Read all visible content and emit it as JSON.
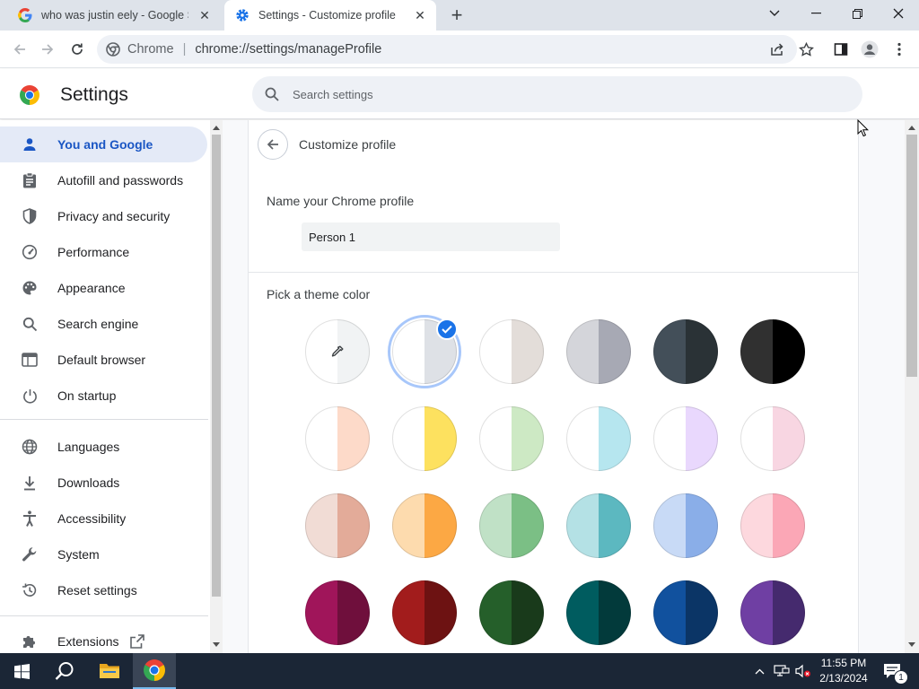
{
  "browser": {
    "tabs": [
      {
        "title": "who was justin eely - Google Search",
        "icon": "google-icon"
      },
      {
        "title": "Settings - Customize profile",
        "icon": "settings-gear-icon"
      }
    ],
    "omnibox": {
      "site": "Chrome",
      "separator": "|",
      "url": "chrome://settings/manageProfile"
    }
  },
  "settings": {
    "title": "Settings",
    "search_placeholder": "Search settings",
    "nav": [
      {
        "label": "You and Google",
        "icon": "person-icon",
        "active": true
      },
      {
        "label": "Autofill and passwords",
        "icon": "clipboard-icon"
      },
      {
        "label": "Privacy and security",
        "icon": "shield-icon"
      },
      {
        "label": "Performance",
        "icon": "speedometer-icon"
      },
      {
        "label": "Appearance",
        "icon": "palette-icon"
      },
      {
        "label": "Search engine",
        "icon": "search-icon"
      },
      {
        "label": "Default browser",
        "icon": "browser-window-icon"
      },
      {
        "label": "On startup",
        "icon": "power-icon"
      },
      {
        "label": "Languages",
        "icon": "globe-icon"
      },
      {
        "label": "Downloads",
        "icon": "download-icon"
      },
      {
        "label": "Accessibility",
        "icon": "accessibility-icon"
      },
      {
        "label": "System",
        "icon": "wrench-icon"
      },
      {
        "label": "Reset settings",
        "icon": "reset-icon"
      },
      {
        "label": "Extensions",
        "icon": "puzzle-icon"
      }
    ]
  },
  "profile": {
    "page_title": "Customize profile",
    "name_label": "Name your Chrome profile",
    "name_value": "Person 1",
    "theme_label": "Pick a theme color",
    "selected_theme_index": 1,
    "themes": [
      {
        "left": "#ffffff",
        "right": "#f1f3f4",
        "custom": true
      },
      {
        "left": "#ffffff",
        "right": "#dee1e6"
      },
      {
        "left": "#ffffff",
        "right": "#e3ddd9"
      },
      {
        "left": "#d4d5da",
        "right": "#a7a9b4"
      },
      {
        "left": "#434f59",
        "right": "#2a3236"
      },
      {
        "left": "#303030",
        "right": "#000000"
      },
      {
        "left": "#ffffff",
        "right": "#fddac9"
      },
      {
        "left": "#ffffff",
        "right": "#fde15f"
      },
      {
        "left": "#ffffff",
        "right": "#cde9c4"
      },
      {
        "left": "#ffffff",
        "right": "#b6e6ef"
      },
      {
        "left": "#ffffff",
        "right": "#e9d8fd"
      },
      {
        "left": "#ffffff",
        "right": "#f8d6e2"
      },
      {
        "left": "#f1dcd5",
        "right": "#e3ab99"
      },
      {
        "left": "#fddbae",
        "right": "#fca844"
      },
      {
        "left": "#c0e1c6",
        "right": "#7bbf85"
      },
      {
        "left": "#b4e1e5",
        "right": "#5cb8c0"
      },
      {
        "left": "#c8daf6",
        "right": "#8aaee8"
      },
      {
        "left": "#fdd8de",
        "right": "#fba7b6"
      },
      {
        "left": "#a0155a",
        "right": "#6f0f3c"
      },
      {
        "left": "#a21c1c",
        "right": "#6d1212"
      },
      {
        "left": "#255f2a",
        "right": "#193a1b"
      },
      {
        "left": "#005c5f",
        "right": "#023a3b"
      },
      {
        "left": "#11519e",
        "right": "#0b3566"
      },
      {
        "left": "#6f3fa3",
        "right": "#452a6e"
      }
    ]
  },
  "taskbar": {
    "time": "11:55 PM",
    "date": "2/13/2024",
    "notification_count": "1"
  }
}
